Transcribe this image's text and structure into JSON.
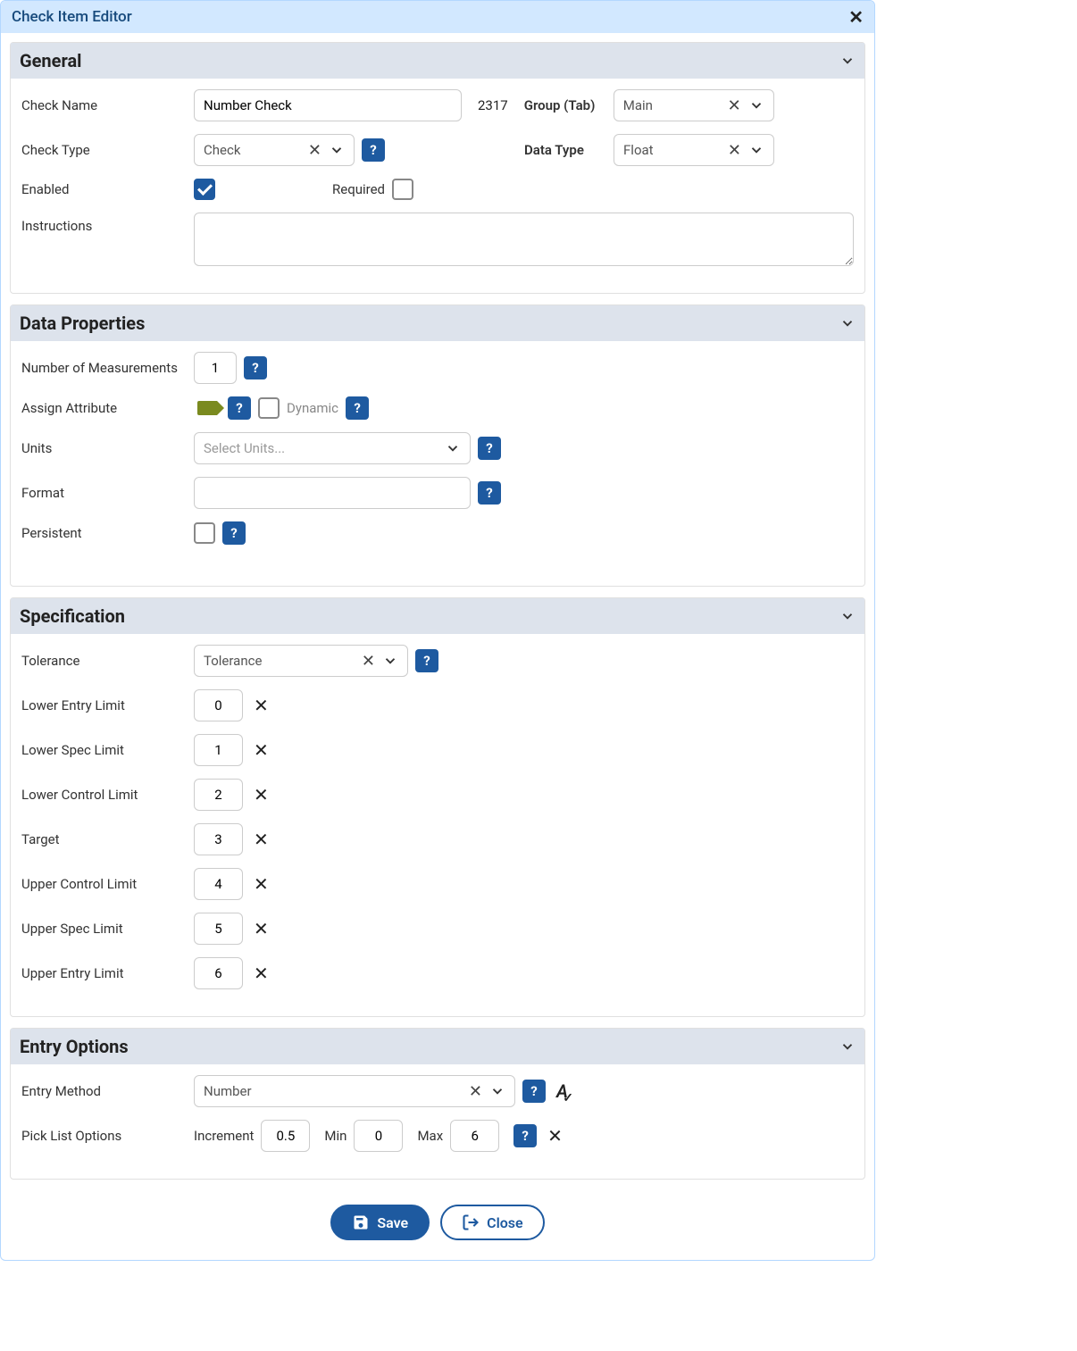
{
  "dialog": {
    "title": "Check Item Editor"
  },
  "sections": {
    "general": {
      "title": "General",
      "checkNameLabel": "Check Name",
      "checkNameValue": "Number Check",
      "id": "2317",
      "groupLabel": "Group (Tab)",
      "groupValue": "Main",
      "checkTypeLabel": "Check Type",
      "checkTypeValue": "Check",
      "dataTypeLabel": "Data Type",
      "dataTypeValue": "Float",
      "enabledLabel": "Enabled",
      "requiredLabel": "Required",
      "instructionsLabel": "Instructions",
      "instructionsValue": ""
    },
    "dataProps": {
      "title": "Data Properties",
      "numMeasLabel": "Number of Measurements",
      "numMeasValue": "1",
      "assignAttrLabel": "Assign Attribute",
      "dynamicLabel": "Dynamic",
      "unitsLabel": "Units",
      "unitsPlaceholder": "Select Units...",
      "formatLabel": "Format",
      "formatValue": "",
      "persistentLabel": "Persistent"
    },
    "spec": {
      "title": "Specification",
      "toleranceLabel": "Tolerance",
      "toleranceValue": "Tolerance",
      "fields": [
        {
          "label": "Lower Entry Limit",
          "value": "0"
        },
        {
          "label": "Lower Spec Limit",
          "value": "1"
        },
        {
          "label": "Lower Control Limit",
          "value": "2"
        },
        {
          "label": "Target",
          "value": "3"
        },
        {
          "label": "Upper Control Limit",
          "value": "4"
        },
        {
          "label": "Upper Spec Limit",
          "value": "5"
        },
        {
          "label": "Upper Entry Limit",
          "value": "6"
        }
      ]
    },
    "entry": {
      "title": "Entry Options",
      "entryMethodLabel": "Entry Method",
      "entryMethodValue": "Number",
      "pickListLabel": "Pick List Options",
      "incrementLabel": "Increment",
      "incrementValue": "0.5",
      "minLabel": "Min",
      "minValue": "0",
      "maxLabel": "Max",
      "maxValue": "6"
    }
  },
  "footer": {
    "save": "Save",
    "close": "Close"
  },
  "icons": {
    "help": "?"
  }
}
